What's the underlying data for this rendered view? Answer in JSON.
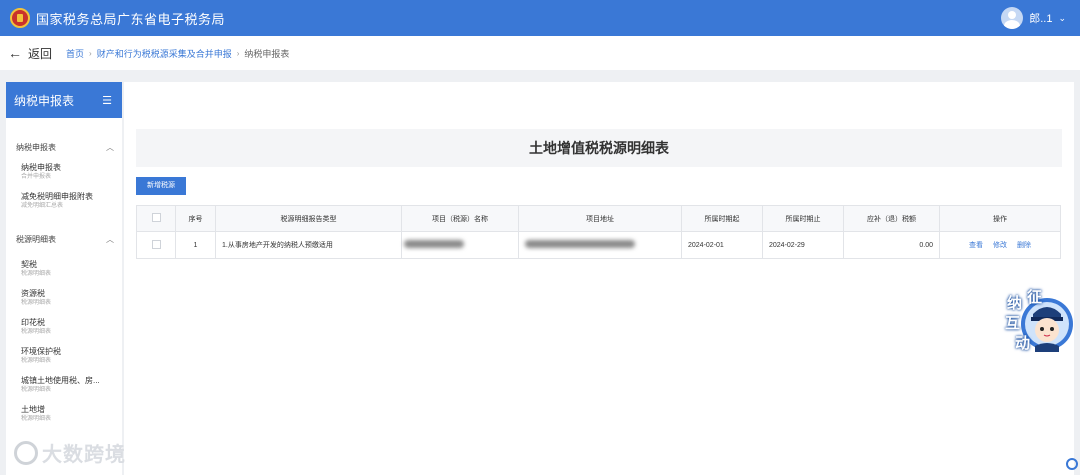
{
  "header": {
    "title": "国家税务总局广东省电子税务局",
    "user_name": "郎..1",
    "user_caret": "⌄"
  },
  "nav": {
    "back_label": "返回",
    "breadcrumbs": [
      "首页",
      "财产和行为税税源采集及合并申报",
      "纳税申报表"
    ]
  },
  "sidebar": {
    "title": "纳税申报表",
    "menu_icon": "☰",
    "groups": [
      {
        "label": "纳税申报表",
        "items": [
          {
            "label": "纳税申报表",
            "sub": "合并申报表"
          },
          {
            "label": "减免税明细申报附表",
            "sub": "减免明细汇总表"
          }
        ]
      },
      {
        "label": "税源明细表",
        "items": [
          {
            "label": "契税",
            "sub": "税源明细表"
          },
          {
            "label": "资源税",
            "sub": "税源明细表"
          },
          {
            "label": "印花税",
            "sub": "税源明细表"
          },
          {
            "label": "环境保护税",
            "sub": "税源明细表"
          },
          {
            "label": "城镇土地使用税、房...",
            "sub": "税源明细表"
          },
          {
            "label": "土地增",
            "sub": "税源明细表"
          }
        ]
      }
    ]
  },
  "main": {
    "form_title": "土地增值税税源明细表",
    "add_button": "新增税源",
    "table": {
      "headers": [
        "序号",
        "税源明细报告类型",
        "项目（税源）名称",
        "项目地址",
        "所属时期起",
        "所属时期止",
        "应补（退）税额",
        "操作"
      ],
      "rows": [
        {
          "index": "1",
          "type": "1.从事房地产开发的纳税人预缴适用",
          "start": "2024-02-01",
          "end": "2024-02-29",
          "amount": "0.00",
          "actions": [
            "查看",
            "修改",
            "删除"
          ]
        }
      ]
    }
  },
  "assistant": {
    "chars": [
      "纳",
      "征",
      "互",
      "动"
    ]
  },
  "watermark": {
    "text": "大数跨境"
  },
  "colors": {
    "primary": "#3a78d6",
    "header_bg": "#3a78d6",
    "page_bg": "#eef0f3"
  }
}
